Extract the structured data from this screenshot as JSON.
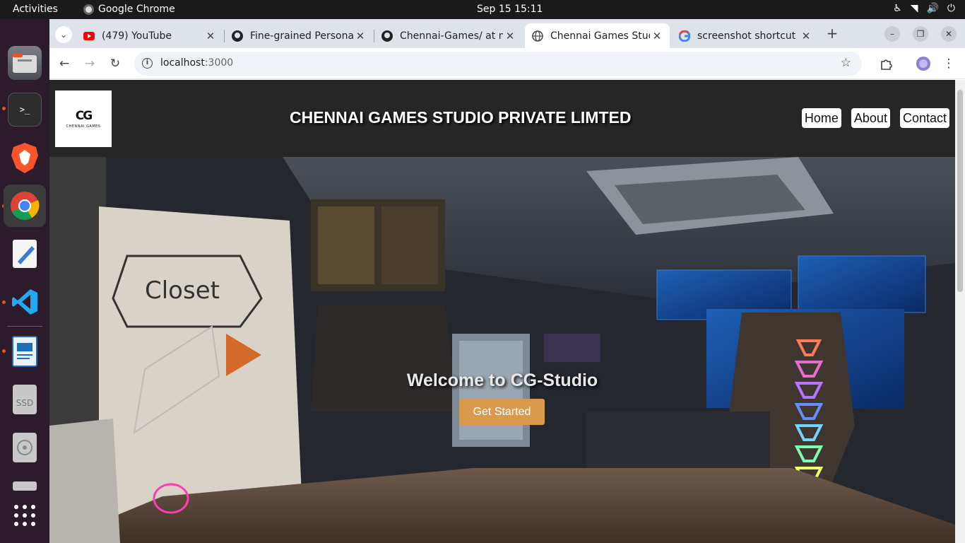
{
  "os": {
    "activities": "Activities",
    "app_name": "Google Chrome",
    "clock": "Sep 15  15:11"
  },
  "browser": {
    "tabs": [
      {
        "title": "(479) YouTube",
        "icon": "youtube-icon"
      },
      {
        "title": "Fine-grained Persona",
        "icon": "github-icon"
      },
      {
        "title": "Chennai-Games/ at m",
        "icon": "github-icon"
      },
      {
        "title": "Chennai Games Stud",
        "icon": "globe-icon",
        "active": true
      },
      {
        "title": "screenshot shortcut",
        "icon": "google-icon"
      }
    ],
    "url_host": "localhost",
    "url_port": ":3000"
  },
  "site": {
    "logo_mark": "CG",
    "logo_word": "CHENNAI GAMES",
    "title": "CHENNAI GAMES STUDIO PRIVATE LIMTED",
    "nav": [
      "Home",
      "About",
      "Contact"
    ],
    "hero": {
      "heading": "Welcome to CG-Studio",
      "cta": "Get Started",
      "cta_color": "#d99a4e"
    }
  },
  "dock": {
    "ssd_label": "SSD"
  }
}
